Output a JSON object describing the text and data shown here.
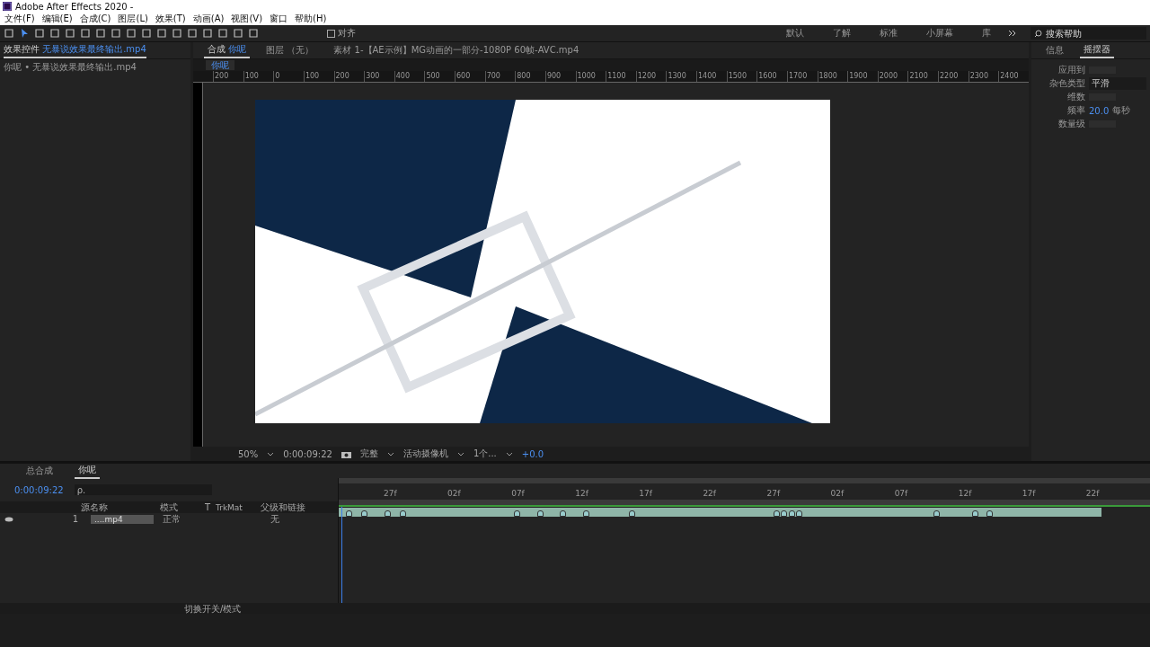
{
  "window": {
    "title": "Adobe After Effects 2020 -"
  },
  "menu": [
    "文件(F)",
    "编辑(E)",
    "合成(C)",
    "图层(L)",
    "效果(T)",
    "动画(A)",
    "视图(V)",
    "窗口",
    "帮助(H)"
  ],
  "toolbar": {
    "align": {
      "label": "对齐",
      "checked": false
    }
  },
  "workspaces": [
    "默认",
    "了解",
    "标准",
    "小屏幕",
    "库"
  ],
  "search_help": {
    "placeholder": "搜索帮助"
  },
  "effect_controls": {
    "tab": "效果控件",
    "file": "无暴说效果最终输出.mp4",
    "breadcrumb": "你呢 • 无暴说效果最终输出.mp4"
  },
  "viewer": {
    "comp_tab": {
      "label": "合成",
      "name": "你呢"
    },
    "layer_tab": "图层 （无）",
    "footage_tab": "素材 1-【AE示例】MG动画的一部分-1080P 60帧-AVC.mp4",
    "comp_subtab": "你呢",
    "ruler": [
      "200",
      "100",
      "0",
      "100",
      "200",
      "300",
      "400",
      "500",
      "600",
      "700",
      "800",
      "900",
      "1000",
      "1100",
      "1200",
      "1300",
      "1400",
      "1500",
      "1600",
      "1700",
      "1800",
      "1900",
      "2000",
      "2100",
      "2200",
      "2300",
      "2400"
    ],
    "bar": {
      "zoom": "50%",
      "time": "0:00:09:22",
      "resolution": "完整",
      "camera": "活动摄像机",
      "views": "1个...",
      "exposure": "+0.0"
    }
  },
  "right_panel": {
    "tabs": [
      {
        "label": "信息",
        "selected": false
      },
      {
        "label": "摇摆器",
        "selected": true
      }
    ],
    "fields": [
      {
        "label": "应用到",
        "kind": "blank"
      },
      {
        "label": "杂色类型",
        "kind": "select",
        "value": "平滑"
      },
      {
        "label": "维数",
        "kind": "blank"
      },
      {
        "label": "频率",
        "kind": "number",
        "value": "20.0",
        "unit": "每秒"
      },
      {
        "label": "数量级",
        "kind": "blank"
      }
    ]
  },
  "timeline": {
    "tabs": [
      {
        "label": "总合成",
        "selected": false
      },
      {
        "label": "你呢",
        "selected": true
      }
    ],
    "time": "0:00:09:22",
    "search": {
      "placeholder": "ρ."
    },
    "columns": [
      "源名称",
      "模式",
      "T",
      "TrkMat",
      "父级和链接"
    ],
    "layers": [
      {
        "number": "1",
        "name": "....mp4",
        "mode": "正常",
        "parent": "无"
      }
    ],
    "ticks": [
      "27f",
      "02f",
      "07f",
      "12f",
      "17f",
      "22f",
      "27f",
      "02f",
      "07f",
      "12f",
      "17f",
      "22f"
    ],
    "footer": "切换开关/模式"
  }
}
